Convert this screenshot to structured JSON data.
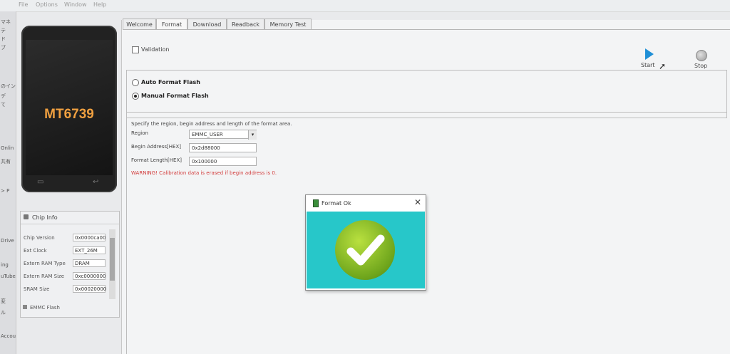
{
  "menubar": {
    "items": [
      "File",
      "Options",
      "Window",
      "Help"
    ]
  },
  "left_strip": {
    "labels": [
      "マネ",
      "テ",
      "ド",
      "ブ",
      "のイン",
      "デ",
      "て",
      "Onlin",
      "共有",
      "> P",
      "Drive",
      "ing",
      "uTube",
      "変",
      "ル",
      "Accou"
    ]
  },
  "device": {
    "model": "MT6739"
  },
  "chip_info": {
    "title": "Chip Info",
    "rows": [
      {
        "label": "Chip Version",
        "value": "0x0000ca00"
      },
      {
        "label": "Ext Clock",
        "value": "EXT_26M"
      },
      {
        "label": "Extern RAM Type",
        "value": "DRAM"
      },
      {
        "label": "Extern RAM Size",
        "value": "0xc0000000"
      },
      {
        "label": "SRAM Size",
        "value": "0x00020000"
      }
    ],
    "emmc_label": "EMMC Flash"
  },
  "tabs": [
    {
      "label": "Welcome",
      "active": false
    },
    {
      "label": "Format",
      "active": true
    },
    {
      "label": "Download",
      "active": false
    },
    {
      "label": "Readback",
      "active": false
    },
    {
      "label": "Memory Test",
      "active": false
    }
  ],
  "validation": {
    "label": "Validation",
    "checked": false
  },
  "toolbar": {
    "start_label": "Start",
    "stop_label": "Stop"
  },
  "format_options": {
    "auto_label": "Auto Format Flash",
    "manual_label": "Manual Format Flash",
    "selected": "manual"
  },
  "region_form": {
    "description": "Specify the region, begin address and length of the format area.",
    "region_label": "Region",
    "region_value": "EMMC_USER",
    "begin_label": "Begin Address[HEX]",
    "begin_value": "0x2d88000",
    "length_label": "Format Length[HEX]",
    "length_value": "0x100000",
    "warning": "WARNING! Calibration data is erased if begin address is 0."
  },
  "dialog": {
    "title": "Format Ok",
    "close_glyph": "✕"
  },
  "colors": {
    "accent": "#1f8fd6",
    "warning": "#d23b3b",
    "dialog_bg": "#27c7c9",
    "check_green": "#7ab321"
  }
}
